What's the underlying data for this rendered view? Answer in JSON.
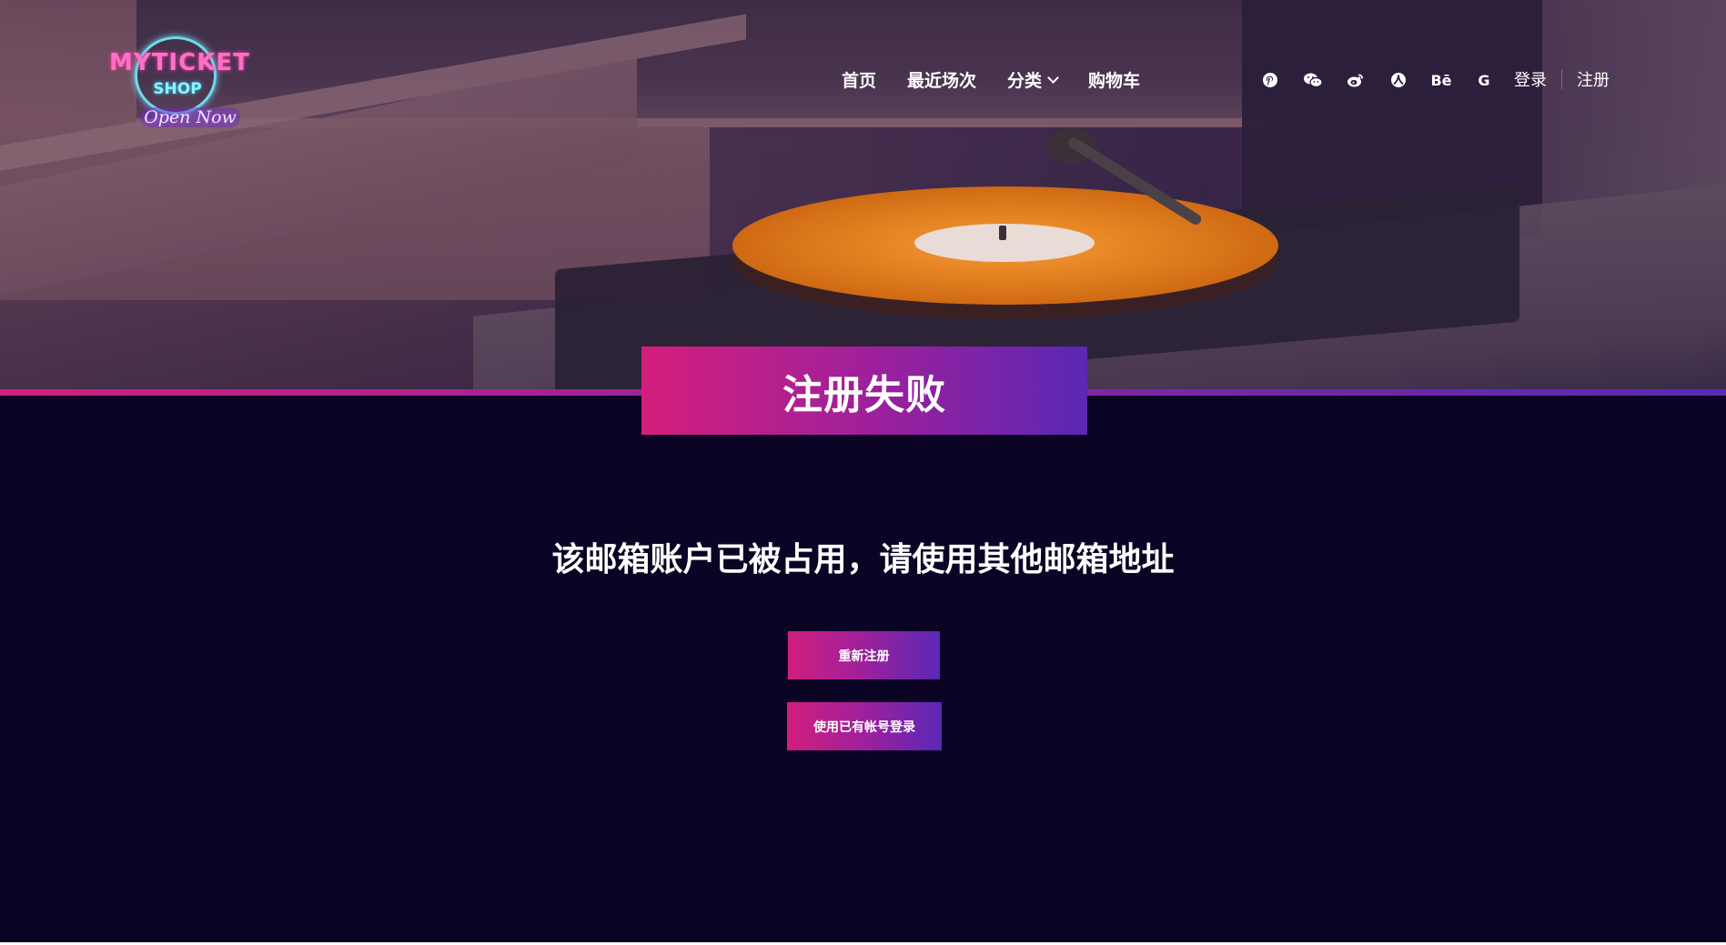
{
  "logo": {
    "brand": "MYTICKET",
    "shop": "SHOP",
    "tagline": "Open Now"
  },
  "nav": {
    "items": [
      {
        "label": "首页"
      },
      {
        "label": "最近场次"
      },
      {
        "label": "分类",
        "has_dropdown": true
      },
      {
        "label": "购物车"
      }
    ]
  },
  "social": {
    "icons": [
      "pinterest-icon",
      "wechat-icon",
      "weibo-icon",
      "renren-icon",
      "behance-icon",
      "google-icon"
    ],
    "behance_text": "Bē",
    "google_text": "G"
  },
  "auth": {
    "login_label": "登录",
    "register_label": "注册"
  },
  "page": {
    "title": "注册失败",
    "message": "该邮箱账户已被占用，请使用其他邮箱地址"
  },
  "buttons": {
    "reregister": "重新注册",
    "login_existing": "使用已有帐号登录"
  },
  "colors": {
    "background": "#0b0424",
    "gradient_start": "#d41e7c",
    "gradient_end": "#5a27b4"
  }
}
